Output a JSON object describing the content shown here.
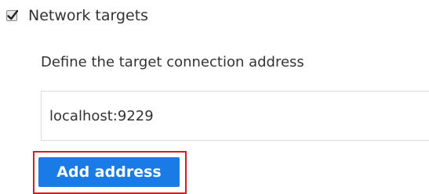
{
  "network_targets": {
    "checked": true,
    "label": "Network targets",
    "check_icon": "checkmark-icon"
  },
  "section": {
    "label": "Define the target connection address"
  },
  "address_input": {
    "value": "localhost:9229",
    "placeholder": ""
  },
  "add_button": {
    "label": "Add address",
    "color": "#1a7ae6"
  },
  "highlight": {
    "color": "#d21f26"
  }
}
